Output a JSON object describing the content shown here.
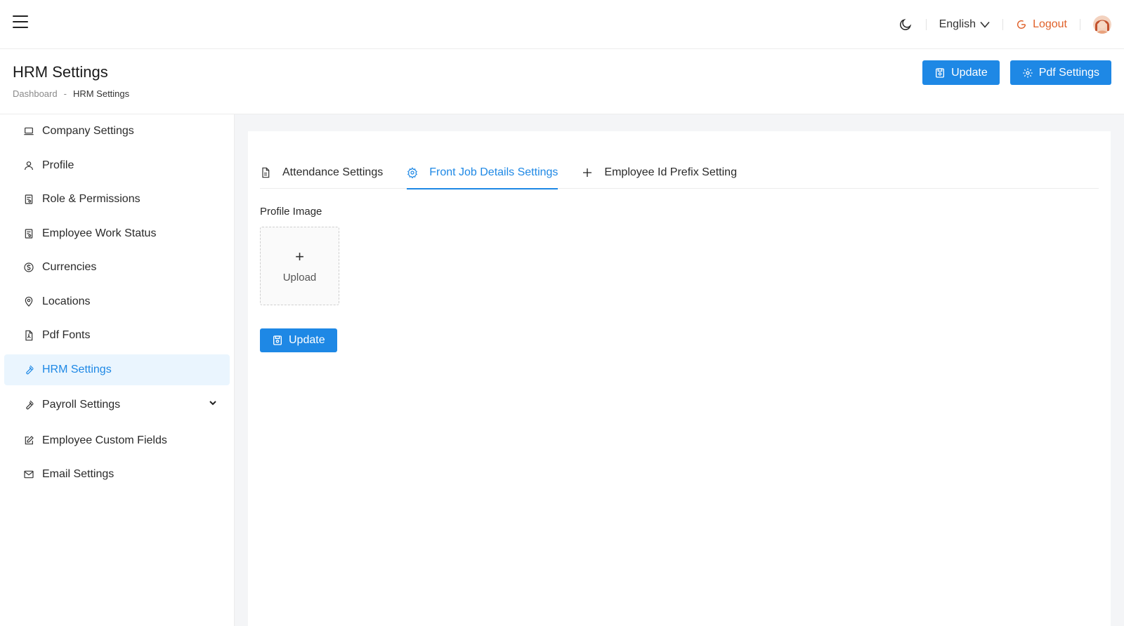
{
  "topbar": {
    "language": "English",
    "logout_label": "Logout"
  },
  "header": {
    "title": "HRM Settings",
    "breadcrumb": [
      "Dashboard",
      "-",
      "HRM Settings"
    ],
    "update_label": "Update",
    "pdf_settings_label": "Pdf Settings"
  },
  "sidebar": {
    "items": [
      {
        "label": "Company Settings",
        "icon": "laptop-icon"
      },
      {
        "label": "Profile",
        "icon": "user-icon"
      },
      {
        "label": "Role & Permissions",
        "icon": "id-card-icon"
      },
      {
        "label": "Employee Work Status",
        "icon": "id-card-icon"
      },
      {
        "label": "Currencies",
        "icon": "dollar-circle-icon"
      },
      {
        "label": "Locations",
        "icon": "location-pin-icon"
      },
      {
        "label": "Pdf Fonts",
        "icon": "pdf-file-icon"
      },
      {
        "label": "HRM Settings",
        "icon": "wrench-icon"
      },
      {
        "label": "Payroll Settings",
        "icon": "wrench-icon"
      },
      {
        "label": "Employee Custom Fields",
        "icon": "edit-icon"
      },
      {
        "label": "Email Settings",
        "icon": "mail-icon"
      }
    ]
  },
  "tabs": [
    {
      "label": "Attendance Settings",
      "icon": "document-icon"
    },
    {
      "label": "Front Job Details Settings",
      "icon": "gear-icon"
    },
    {
      "label": "Employee Id Prefix Setting",
      "icon": "plus-icon"
    }
  ],
  "form": {
    "profile_image_label": "Profile Image",
    "upload_label": "Upload",
    "update_label": "Update"
  },
  "colors": {
    "primary": "#1e88e5",
    "logout": "#e0612a",
    "active_bg": "#eaf5fe"
  }
}
